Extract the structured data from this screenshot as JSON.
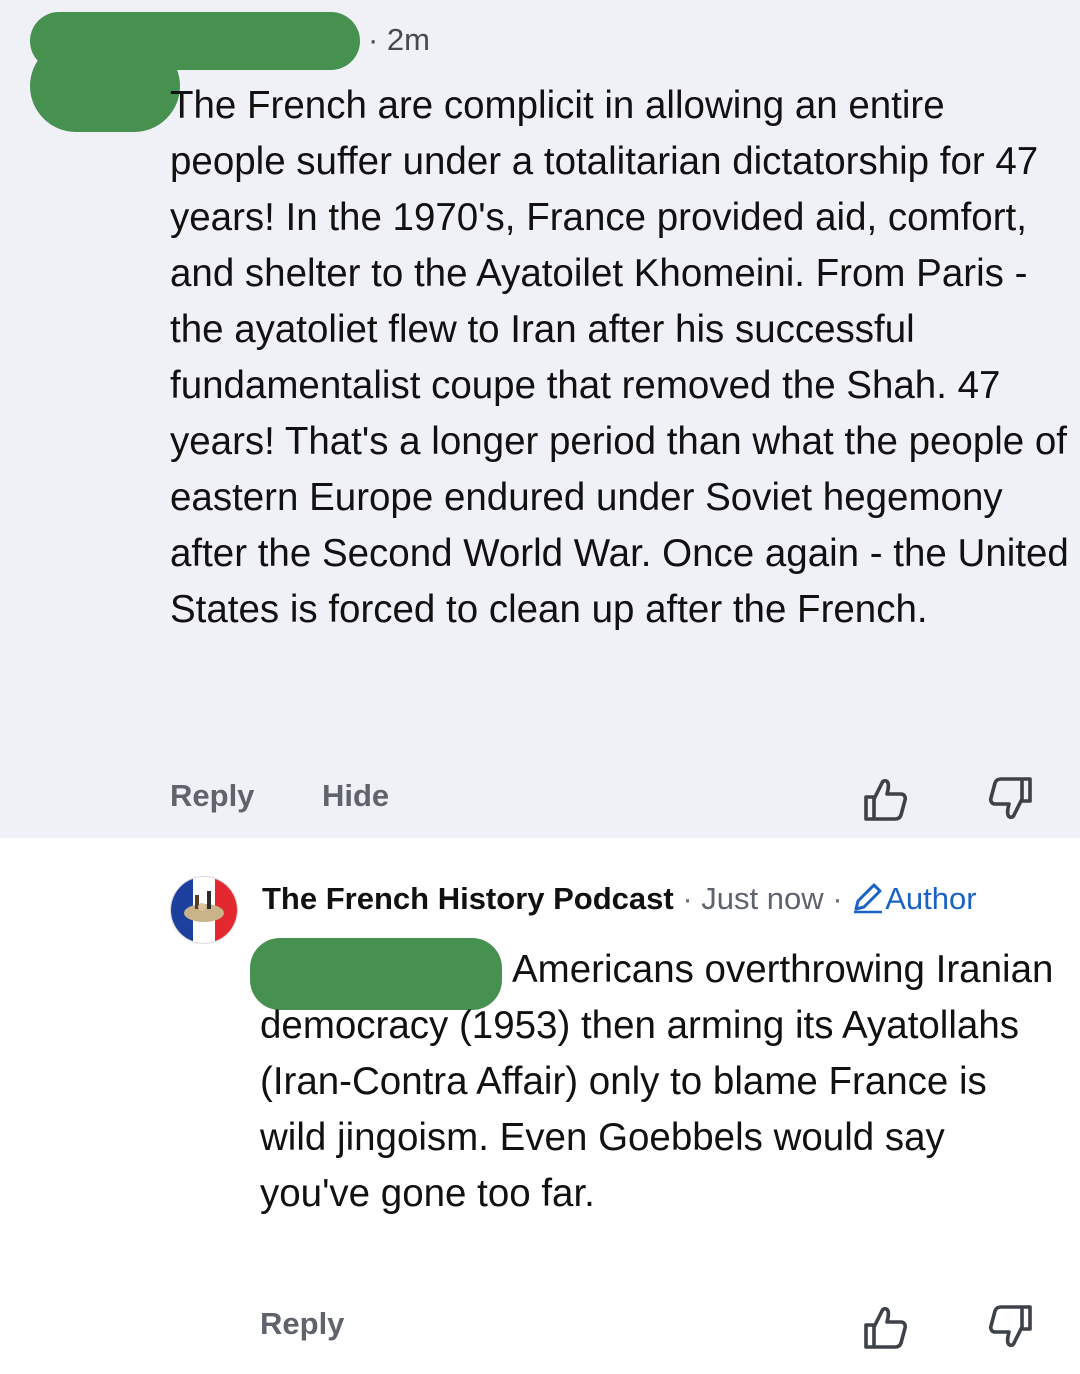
{
  "comments": [
    {
      "time": "· 2m",
      "text": "The French are complicit in allowing an entire people suffer under a totalitarian dictatorship for 47 years! In the 1970's, France provided aid, comfort, and shelter to the Ayatoilet Khomeini. From Paris - the ayatoliet flew to Iran after his successful fundamentalist coupe that removed the Shah. 47 years! That's a longer period than what the people of eastern Europe endured under Soviet hegemony after the Second World War. Once again - the United States is forced to clean up after the French.",
      "actions": {
        "reply": "Reply",
        "hide": "Hide"
      },
      "icons": {
        "like": "thumbs-up-icon",
        "dislike": "thumbs-down-icon"
      }
    },
    {
      "author": "The French History Podcast",
      "separator": "·",
      "time": "Just now",
      "badge": "Author",
      "text": "Americans overthrowing Iranian democracy (1953) then arming its Ayatollahs (Iran-Contra Affair) only to blame France is wild jingoism. Even Goebbels would say you've gone too far.",
      "actions": {
        "reply": "Reply"
      },
      "icons": {
        "avatar": "french-flag-avatar",
        "badge": "pencil-icon",
        "like": "thumbs-up-icon",
        "dislike": "thumbs-down-icon"
      }
    }
  ],
  "colors": {
    "background_top": "#f0f1f6",
    "background_bottom": "#ffffff",
    "redaction": "#479150",
    "author_badge": "#1a62c6",
    "action_text": "#5f646c"
  }
}
